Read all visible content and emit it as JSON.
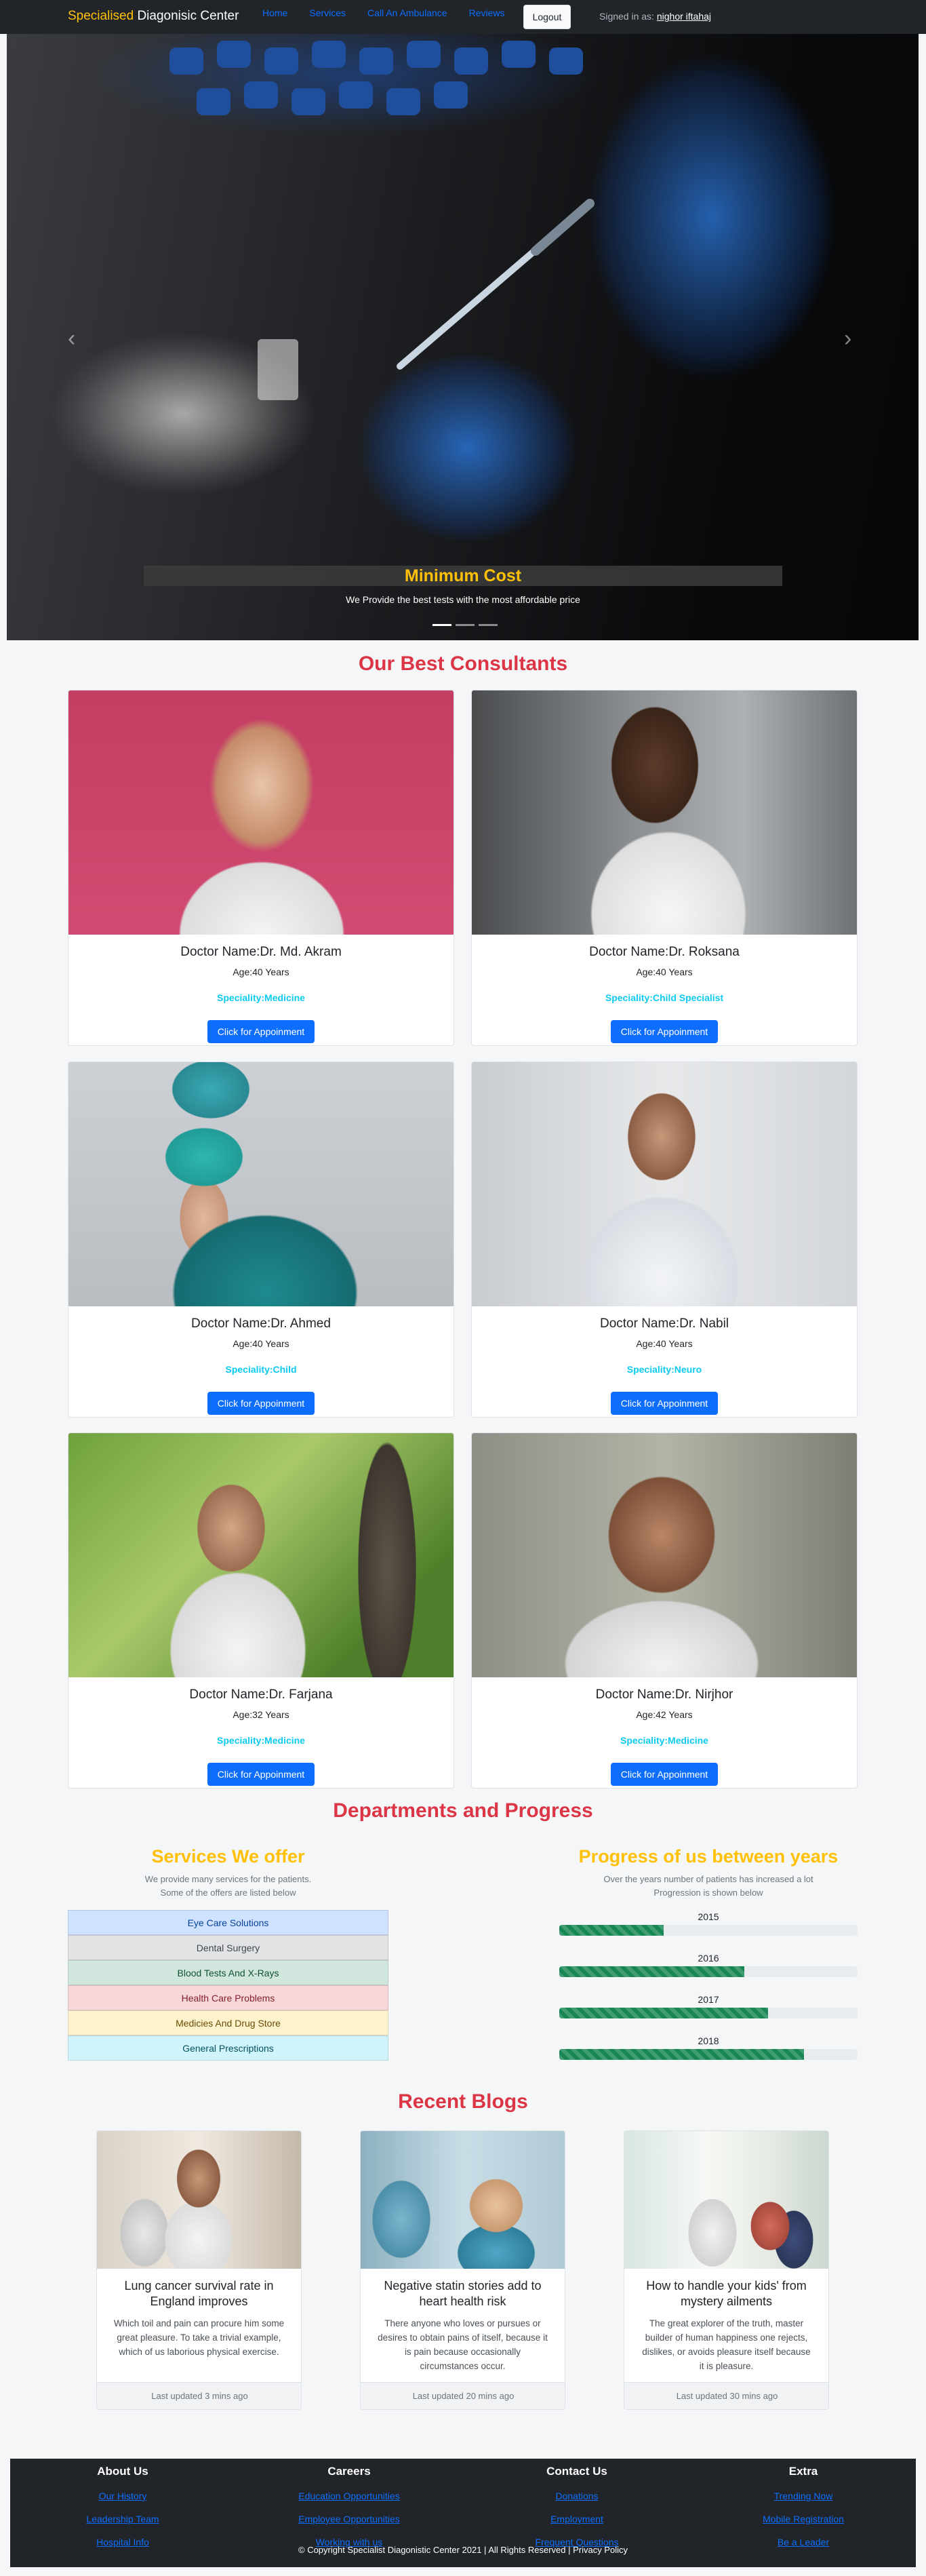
{
  "nav": {
    "brand_accent": "Specialised",
    "brand_rest": " Diagonisic Center",
    "links": [
      "Home",
      "Services",
      "Call An Ambulance",
      "Reviews"
    ],
    "logout": "Logout",
    "signed_prefix": "Signed in as: ",
    "signed_user": "nighor iftahaj"
  },
  "hero": {
    "title": "Minimum Cost",
    "subtitle": "We Provide the best tests with the most affordable price",
    "prev_icon": "chevron-left-icon",
    "next_icon": "chevron-right-icon",
    "prev_glyph": "‹",
    "next_glyph": "›",
    "slide_count": 3,
    "active_slide": 1
  },
  "consultants": {
    "title": "Our Best Consultants",
    "button_label": "Click for Appoinment",
    "doctors": [
      {
        "name": "Doctor Name:Dr. Md. Akram",
        "age": "Age:40 Years",
        "speciality": "Speciality:Medicine"
      },
      {
        "name": "Doctor Name:Dr. Roksana",
        "age": "Age:40 Years",
        "speciality": "Speciality:Child Specialist"
      },
      {
        "name": "Doctor Name:Dr. Ahmed",
        "age": "Age:40 Years",
        "speciality": "Speciality:Child"
      },
      {
        "name": "Doctor Name:Dr. Nabil",
        "age": "Age:40 Years",
        "speciality": "Speciality:Neuro"
      },
      {
        "name": "Doctor Name:Dr. Farjana",
        "age": "Age:32 Years",
        "speciality": "Speciality:Medicine"
      },
      {
        "name": "Doctor Name:Dr. Nirjhor",
        "age": "Age:42 Years",
        "speciality": "Speciality:Medicine"
      }
    ]
  },
  "departments": {
    "title": "Departments and Progress",
    "services_title": "Services We offer",
    "services_sub1": "We provide many services for the patients.",
    "services_sub2": "Some of the offers are listed below",
    "services": [
      {
        "label": "Eye Care Solutions",
        "bg": "#cfe2ff",
        "color": "#084298"
      },
      {
        "label": "Dental Surgery",
        "bg": "#e2e3e5",
        "color": "#41464b"
      },
      {
        "label": "Blood Tests And X-Rays",
        "bg": "#d1e7dd",
        "color": "#0f5132"
      },
      {
        "label": "Health Care Problems",
        "bg": "#f8d7da",
        "color": "#842029"
      },
      {
        "label": "Medicies And Drug Store",
        "bg": "#fff3cd",
        "color": "#664d03"
      },
      {
        "label": "General Prescriptions",
        "bg": "#cff4fc",
        "color": "#055160"
      }
    ],
    "progress_title": "Progress of us between years",
    "progress_sub1": "Over the years number of patients has increased a lot",
    "progress_sub2": "Progression is shown below",
    "progress": [
      {
        "year": "2015",
        "fraction": 0.35
      },
      {
        "year": "2016",
        "fraction": 0.62
      },
      {
        "year": "2017",
        "fraction": 0.7
      },
      {
        "year": "2018",
        "fraction": 0.82
      }
    ]
  },
  "blogs": {
    "title": "Recent Blogs",
    "items": [
      {
        "title": "Lung cancer survival rate in England improves",
        "text": "Which toil and pain can procure him some great pleasure. To take a trivial example, which of us laborious physical exercise.",
        "updated": "Last updated 3 mins ago"
      },
      {
        "title": "Negative statin stories add to heart health risk",
        "text": "There anyone who loves or pursues or desires to obtain pains of itself, because it is pain because occasionally circumstances occur.",
        "updated": "Last updated 20 mins ago"
      },
      {
        "title": "How to handle your kids' from mystery ailments",
        "text": "The great explorer of the truth, master builder of human happiness one rejects, dislikes, or avoids pleasure itself because it is pleasure.",
        "updated": "Last updated 30 mins ago"
      }
    ]
  },
  "footer": {
    "columns": [
      {
        "head": "About Us",
        "links": [
          "Our History",
          "Leadership Team",
          "Hospital Info"
        ]
      },
      {
        "head": "Careers",
        "links": [
          "Education Opportunities",
          "Employee Opportunities",
          "Working with us"
        ]
      },
      {
        "head": "Contact Us",
        "links": [
          "Donations",
          "Employment",
          "Frequent Questions"
        ]
      },
      {
        "head": "Extra",
        "links": [
          "Trending Now",
          "Mobile Registration",
          "Be a Leader"
        ]
      }
    ],
    "copyright": "© Copyright Specialist Diagonistic Center 2021 | All Rights Reserved | Privacy Policy"
  }
}
